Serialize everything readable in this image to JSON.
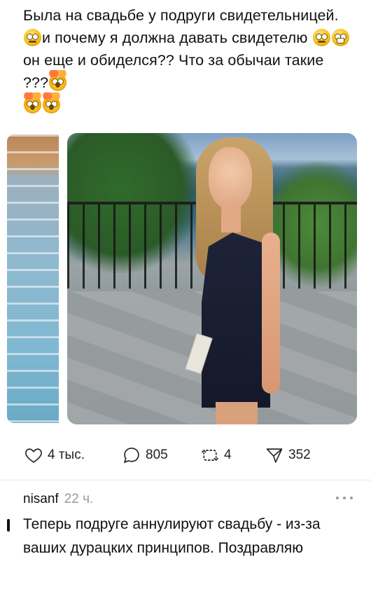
{
  "post": {
    "text_part1": "Была на свадьбе у подруги свидетельницей.",
    "text_part2": "и почему я должна давать свидетелю ",
    "text_part3": "он еще и обиделся?? Что за обычаи такие ???",
    "emojis": [
      "face-with-rolling-eyes-emoji",
      "face-with-rolling-eyes-emoji",
      "grimacing-face-emoji",
      "exploding-head-emoji",
      "exploding-head-emoji",
      "exploding-head-emoji"
    ]
  },
  "actions": {
    "likes": "4 тыс.",
    "comments": "805",
    "reposts": "4",
    "shares": "352"
  },
  "comment": {
    "author": "nisanf",
    "time": "22 ч.",
    "text": "Теперь подруге аннулируют свадьбу - из-за ваших дурацких принципов. Поздравляю"
  }
}
